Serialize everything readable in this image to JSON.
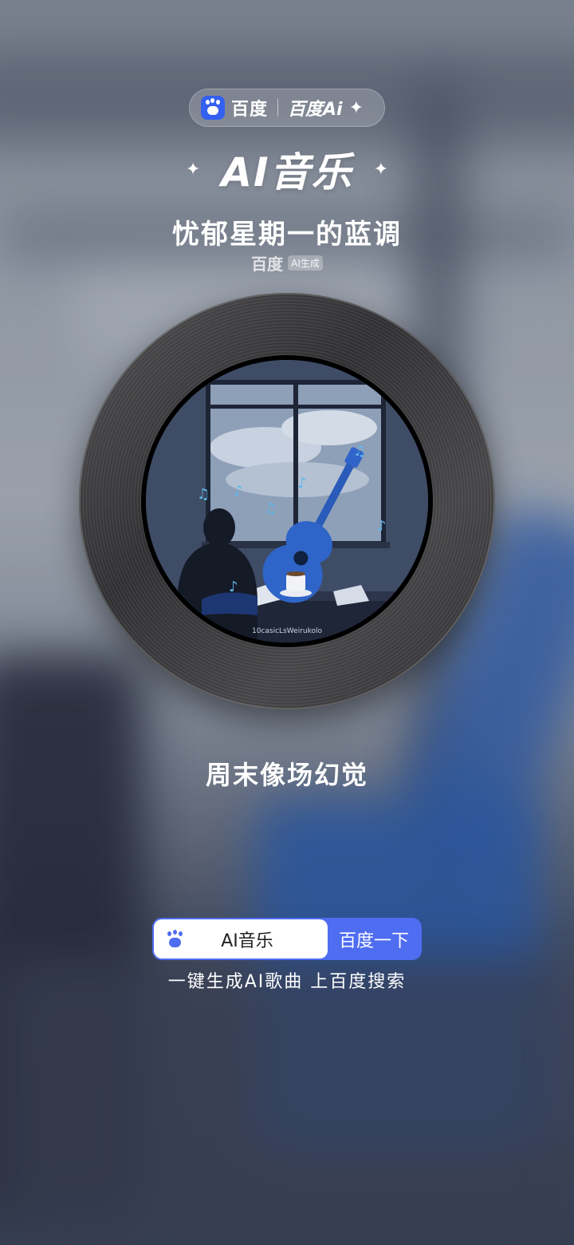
{
  "brand": {
    "name": "百度",
    "ai_name": "百度Ai"
  },
  "header": {
    "title": "AI音乐",
    "sparkle": "✦"
  },
  "song": {
    "title": "忧郁星期一的蓝调",
    "source": "百度",
    "source_tag": "AI生成"
  },
  "cover": {
    "signature": "10casicLsWeirukolo"
  },
  "lyric": "周末像场幻觉",
  "search": {
    "value": "AI音乐",
    "button": "百度一下"
  },
  "tagline": "一键生成AI歌曲 上百度搜索",
  "colors": {
    "accent": "#4f6df0",
    "brand_blue": "#3360f0",
    "guitar_blue": "#2f64c8"
  }
}
